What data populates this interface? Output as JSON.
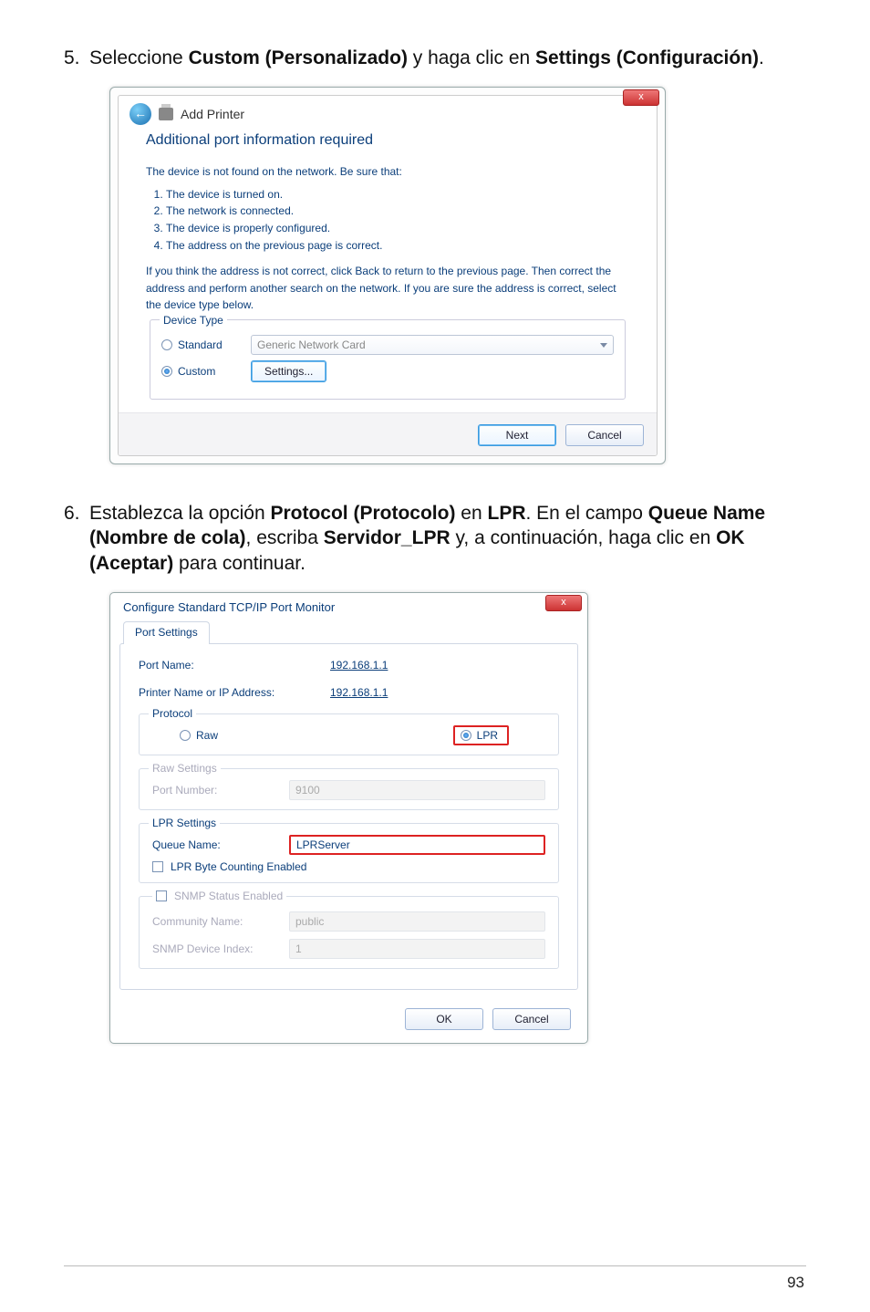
{
  "step5": {
    "num": "5.",
    "pre": "Seleccione ",
    "bold1": "Custom (Personalizado)",
    "mid": "  y haga clic en ",
    "bold2": "Settings (Configuración)",
    "post": "."
  },
  "step6": {
    "num": "6.",
    "pre": "Establezca la opción ",
    "bold1": "Protocol (Protocolo)",
    "mid1": " en ",
    "bold2": "LPR",
    "mid2": ". En el campo ",
    "bold3": "Queue Name (Nombre de cola)",
    "mid3": ", escriba ",
    "bold4": "Servidor_LPR",
    "mid4": " y, a continuación, haga clic en ",
    "bold5": "OK (Aceptar)",
    "post": " para continuar."
  },
  "dlg1": {
    "title": "Add Printer",
    "close": "x",
    "heading": "Additional port information required",
    "notfound": "The device is not found on the network.  Be sure that:",
    "li1": "The device is turned on.",
    "li2": "The network is connected.",
    "li3": "The device is properly configured.",
    "li4": "The address on the previous page is correct.",
    "paragraph": "If you think the address is not correct, click Back to return to the previous page.  Then correct the address and perform another search on the network.  If you are sure the address is correct, select the device type below.",
    "group": "Device Type",
    "standard": "Standard",
    "combo": "Generic Network Card",
    "custom": "Custom",
    "settings": "Settings...",
    "next": "Next",
    "cancel": "Cancel"
  },
  "dlg2": {
    "title": "Configure Standard TCP/IP Port Monitor",
    "close": "x",
    "tab": "Port Settings",
    "portname_lbl": "Port Name:",
    "portname_val": "192.168.1.1",
    "printer_lbl": "Printer Name or IP Address:",
    "printer_val": "192.168.1.1",
    "protocol": "Protocol",
    "raw": "Raw",
    "lpr": "LPR",
    "rawset": "Raw Settings",
    "rawport_lbl": "Port Number:",
    "rawport_val": "9100",
    "lprset": "LPR Settings",
    "queue_lbl": "Queue Name:",
    "queue_val": "LPRServer",
    "byte": "LPR Byte Counting Enabled",
    "snmp": "SNMP Status Enabled",
    "comm_lbl": "Community Name:",
    "comm_val": "public",
    "idx_lbl": "SNMP Device Index:",
    "idx_val": "1",
    "ok": "OK",
    "cancel": "Cancel"
  },
  "page": "93"
}
